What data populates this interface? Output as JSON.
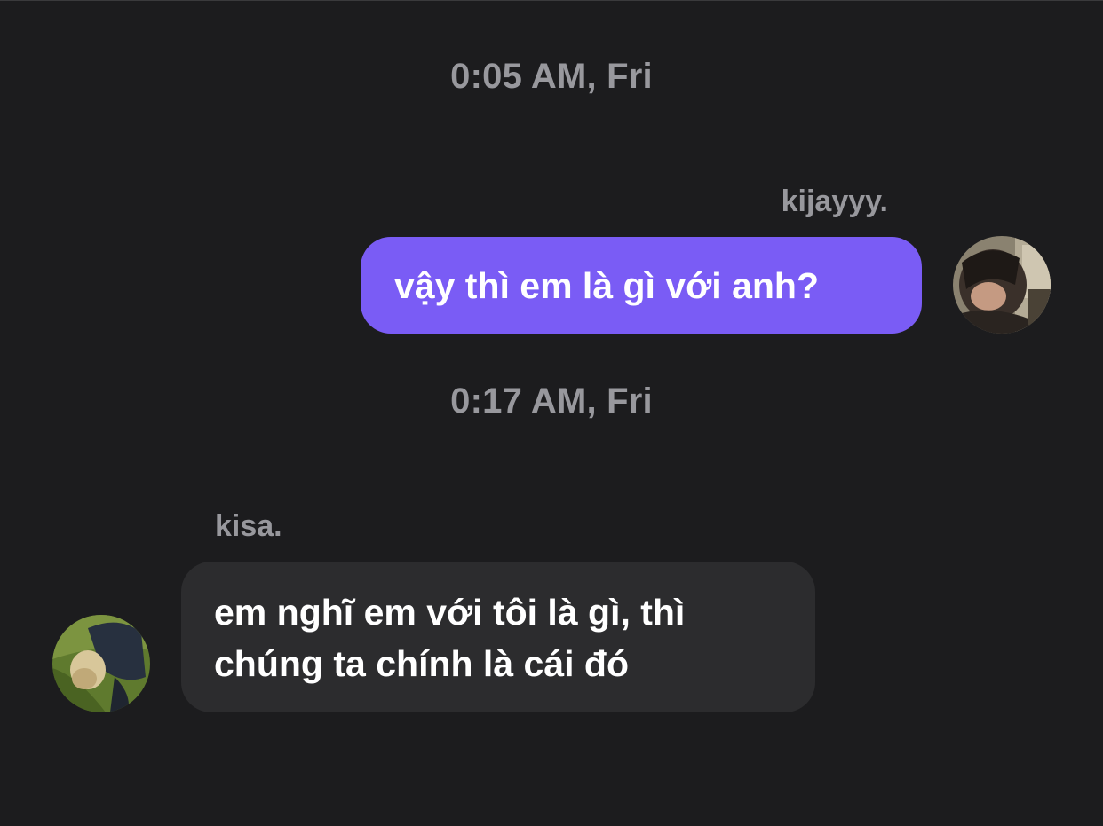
{
  "conversation": {
    "messages": [
      {
        "timestamp": "0:05 AM, Fri",
        "sender": "kijayyy.",
        "direction": "outgoing",
        "lines": [
          "vậy thì em là gì với anh?"
        ],
        "bubble_color": "#7a5cf5"
      },
      {
        "timestamp": "0:17 AM, Fri",
        "sender": "kisa.",
        "direction": "incoming",
        "lines": [
          "em nghĩ em với tôi là gì, thì",
          "chúng ta chính là cái đó"
        ],
        "bubble_color": "#2c2c2e"
      }
    ]
  },
  "theme": {
    "background": "#1c1c1e",
    "muted_text": "#98989d",
    "text": "#ffffff"
  }
}
